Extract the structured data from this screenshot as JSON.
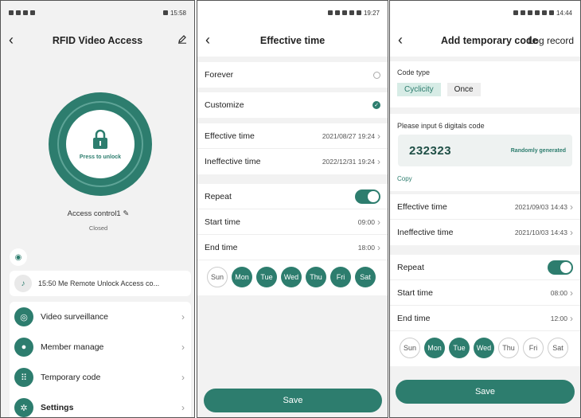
{
  "screen1": {
    "status_time": "15:58",
    "title": "RFID Video Access",
    "lock_label": "Press to unlock",
    "access_name": "Access control1",
    "access_status": "Closed",
    "notice": "15:50 Me  Remote Unlock Access co...",
    "menu": [
      {
        "label": "Video surveillance",
        "icon": "camera-icon"
      },
      {
        "label": "Member manage",
        "icon": "person-icon"
      },
      {
        "label": "Temporary code",
        "icon": "keypad-icon"
      },
      {
        "label": "Settings",
        "icon": "gear-icon"
      }
    ],
    "accent": "#2d7d6e"
  },
  "screen2": {
    "status_time": "19:27",
    "title": "Effective time",
    "forever": "Forever",
    "customize": "Customize",
    "effective_label": "Effective time",
    "effective_value": "2021/08/27 19:24",
    "ineffective_label": "Ineffective time",
    "ineffective_value": "2022/12/31 19:24",
    "repeat": "Repeat",
    "start_label": "Start time",
    "start_value": "09:00",
    "end_label": "End time",
    "end_value": "18:00",
    "days": [
      "Sun",
      "Mon",
      "Tue",
      "Wed",
      "Thu",
      "Fri",
      "Sat"
    ],
    "days_on": [
      false,
      true,
      true,
      true,
      true,
      true,
      true
    ],
    "save": "Save"
  },
  "screen3": {
    "status_time": "14:44",
    "title": "Add temporary code",
    "right_action": "Log record",
    "code_type_label": "Code type",
    "type_options": [
      "Cyclicity",
      "Once"
    ],
    "prompt": "Please input 6 digitals code",
    "code": "232323",
    "generate": "Randomly generated",
    "copy": "Copy",
    "effective_label": "Effective time",
    "effective_value": "2021/09/03 14:43",
    "ineffective_label": "Ineffective time",
    "ineffective_value": "2021/10/03 14:43",
    "repeat": "Repeat",
    "start_label": "Start time",
    "start_value": "08:00",
    "end_label": "End time",
    "end_value": "12:00",
    "days": [
      "Sun",
      "Mon",
      "Tue",
      "Wed",
      "Thu",
      "Fri",
      "Sat"
    ],
    "days_on": [
      false,
      true,
      true,
      true,
      false,
      false,
      false
    ],
    "save": "Save"
  }
}
